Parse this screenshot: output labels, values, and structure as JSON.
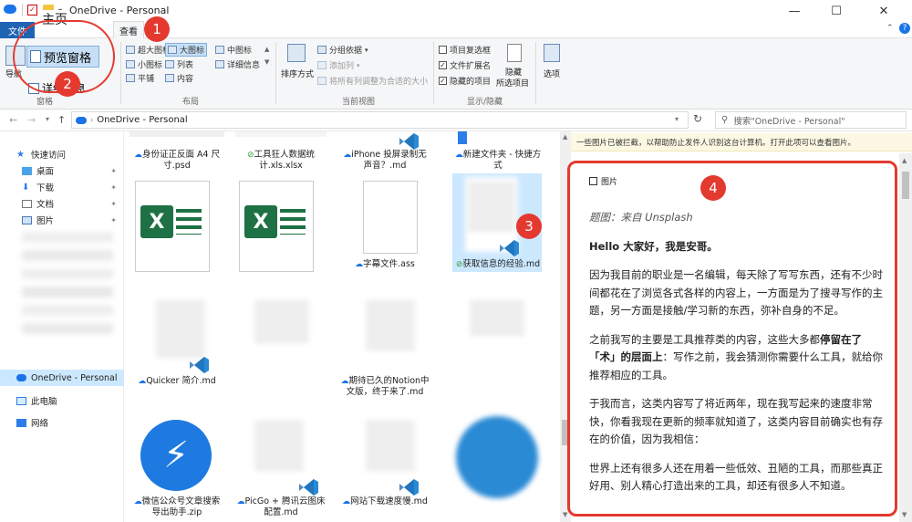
{
  "window": {
    "title": "OneDrive - Personal",
    "minimize": "—",
    "maximize": "☐",
    "close": "✕",
    "help": "?"
  },
  "ribbon_tabs": {
    "file": "文件",
    "home": "主页",
    "view": "查看"
  },
  "ribbon": {
    "nav_pane": "导航",
    "preview_pane": "预览窗格",
    "details_pane": "详细信息",
    "panes_group": "窗格",
    "layout": {
      "extra_large": "超大图标",
      "large": "大图标",
      "medium": "中图标",
      "small": "小图标",
      "list": "列表",
      "details": "详细信息",
      "tiles": "平铺",
      "content": "内容",
      "group_label": "布局"
    },
    "current_view": {
      "sort_by": "排序方式",
      "group_by": "分组依据",
      "add_columns": "添加列",
      "size_all_columns": "将所有列调整为合适的大小",
      "group_label": "当前视图"
    },
    "show_hide": {
      "item_check_boxes": "项目复选框",
      "file_name_extensions": "文件扩展名",
      "hidden_items": "隐藏的项目",
      "hide_selected": "隐藏",
      "hide_selected_2": "所选项目",
      "group_label": "显示/隐藏",
      "item_check_boxes_checked": false,
      "file_name_extensions_checked": true,
      "hidden_items_checked": true
    },
    "options": "选项"
  },
  "address_bar": {
    "path": "OneDrive - Personal",
    "search_placeholder": "搜索\"OneDrive - Personal\""
  },
  "nav_pane": {
    "quick_access": "快速访问",
    "items": [
      {
        "label": "桌面",
        "pinned": true
      },
      {
        "label": "下载",
        "pinned": true
      },
      {
        "label": "文档",
        "pinned": true
      },
      {
        "label": "图片",
        "pinned": true
      }
    ],
    "onedrive": "OneDrive - Personal",
    "this_pc": "此电脑",
    "network": "网络"
  },
  "files": {
    "row1": [
      {
        "name": "身份证正反面 A4 尺寸.psd",
        "status": "cloud"
      },
      {
        "name": "工具狂人数据统计.xls.xlsx",
        "status": "check"
      },
      {
        "name": "iPhone 投屏录制无声音？.md",
        "status": "cloud"
      },
      {
        "name": "新建文件夹 - 快捷方式",
        "status": "cloud"
      }
    ],
    "row2": [
      {
        "name": "",
        "status": ""
      },
      {
        "name": "",
        "status": ""
      },
      {
        "name": "字幕文件.ass",
        "status": "cloud"
      },
      {
        "name": "获取信息的经验.md",
        "status": "check",
        "selected": true
      }
    ],
    "row3": [
      {
        "name": "Quicker 简介.md",
        "status": "cloud"
      },
      {
        "name": "",
        "status": ""
      },
      {
        "name": "期待已久的Notion中文版，终于来了.md",
        "status": "cloud"
      },
      {
        "name": "",
        "status": ""
      }
    ],
    "row4": [
      {
        "name": "微信公众号文章搜索导出助手.zip",
        "status": "cloud"
      },
      {
        "name": "PicGo + 腾讯云图床配置.md",
        "status": "cloud"
      },
      {
        "name": "网站下载速度慢.md",
        "status": "cloud"
      },
      {
        "name": "",
        "status": ""
      }
    ]
  },
  "preview": {
    "info_bar": "一些图片已被拦截，以帮助防止发件人识别这台计算机。打开此项可以查看图片。",
    "image_label": "图片",
    "caption": "题图：来自 Unsplash",
    "greeting": "Hello 大家好，我是安哥。",
    "p1": "因为我目前的职业是一名编辑，每天除了写写东西，还有不少时间都花在了浏览各式各样的内容上，一方面是为了搜寻写作的主题，另一方面是接触/学习新的东西，弥补自身的不足。",
    "p2_a": "之前我写的主要是工具推荐类的内容，这些大多都",
    "p2_b": "停留在了「术」的层面上",
    "p2_c": "：写作之前，我会猜测你需要什么工具，就给你推荐相应的工具。",
    "p3": "于我而言，这类内容写了将近两年，现在我写起来的速度非常快，你看我现在更新的频率就知道了，这类内容目前确实也有存在的价值，因为我相信：",
    "p4": "世界上还有很多人还在用着一些低效、丑陋的工具，而那些真正好用、别人精心打造出来的工具，却还有很多人不知道。"
  },
  "annotations": {
    "b1": "1",
    "b2": "2",
    "b3": "3",
    "b4": "4"
  },
  "colors": {
    "accent_red": "#e4392f",
    "file_tab_blue": "#1e64b4",
    "selection": "#cce8ff",
    "excel_green": "#1d7144",
    "vscode_blue": "#2a8ad4"
  }
}
